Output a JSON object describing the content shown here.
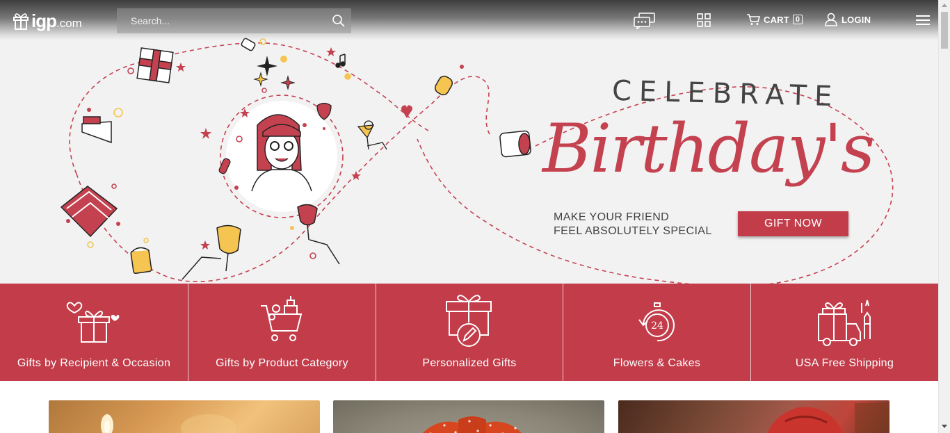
{
  "header": {
    "logo_text": "igp",
    "logo_suffix": ".com",
    "search_placeholder": "Search...",
    "cart_label": "CART",
    "cart_count": "0",
    "login_label": "LOGIN",
    "icons": [
      "chat-icon",
      "grid-icon",
      "cart-icon",
      "user-icon",
      "menu-icon",
      "search-icon"
    ]
  },
  "banner": {
    "celebrate": "CELEBRATE",
    "birthdays": "Birthday's",
    "tagline_line1": "MAKE YOUR FRIEND",
    "tagline_line2": "FEEL ABSOLUTELY SPECIAL",
    "cta_label": "GIFT NOW"
  },
  "categories": [
    {
      "label": "Gifts by Recipient & Occasion",
      "icon": "gift-box-heart-icon"
    },
    {
      "label": "Gifts by Product Category",
      "icon": "gift-cart-icon"
    },
    {
      "label": "Personalized Gifts",
      "icon": "gift-pen-icon"
    },
    {
      "label": "Flowers & Cakes",
      "icon": "timer-24-icon"
    },
    {
      "label": "USA Free Shipping",
      "icon": "truck-liberty-icon"
    }
  ],
  "colors": {
    "accent": "#c23c4a",
    "banner_bg": "#f2f2f3",
    "text_dark": "#444444"
  }
}
